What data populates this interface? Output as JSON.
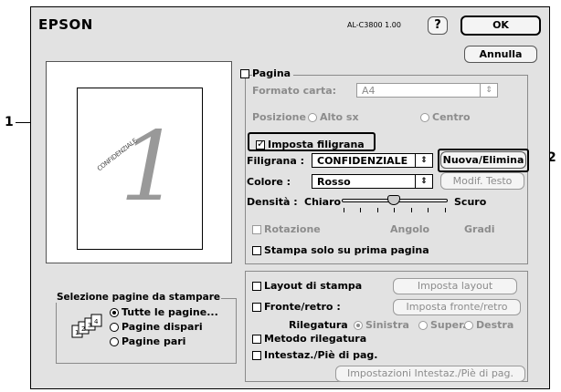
{
  "brand": "EPSON",
  "model": "AL-C3800 1.00",
  "help_label": "?",
  "ok_label": "OK",
  "cancel_label": "Annulla",
  "preview": {
    "page_number": "1",
    "watermark_text": "CONFIDENZIALE"
  },
  "page_selection": {
    "title": "Selezione pagine da stampare",
    "options": [
      "Tutte le pagine...",
      "Pagine dispari",
      "Pagine pari"
    ],
    "selected": "Tutte le pagine..."
  },
  "pagina": {
    "checkbox_label": "Pagina",
    "paper_label": "Formato carta:",
    "paper_value": "A4",
    "position_label": "Posizione :",
    "position_options": [
      "Alto sx",
      "Centro"
    ]
  },
  "watermark": {
    "checkbox_label": "Imposta filigrana",
    "checked": true,
    "filigrana_label": "Filigrana :",
    "filigrana_value": "CONFIDENZIALE",
    "new_delete_label": "Nuova/Elimina",
    "color_label": "Colore :",
    "color_value": "Rosso",
    "modify_text_label": "Modif. Testo",
    "density_label": "Densità :",
    "density_low": "Chiaro",
    "density_high": "Scuro",
    "rotation_label": "Rotazione",
    "angle_label": "Angolo",
    "degrees_label": "Gradi",
    "first_page_label": "Stampa solo su prima pagina"
  },
  "layout": {
    "layout_label": "Layout di stampa",
    "layout_button": "Imposta layout",
    "duplex_label": "Fronte/retro :",
    "duplex_button": "Imposta fronte/retro",
    "binding_label": "Rilegatura",
    "binding_options": [
      "Sinistra",
      "Super.",
      "Destra"
    ],
    "binding_method_label": "Metodo rilegatura",
    "header_footer_label": "Intestaz./Piè di pag.",
    "header_footer_button": "Impostazioni Intestaz./Piè di pag."
  },
  "callouts": [
    "1",
    "2"
  ]
}
